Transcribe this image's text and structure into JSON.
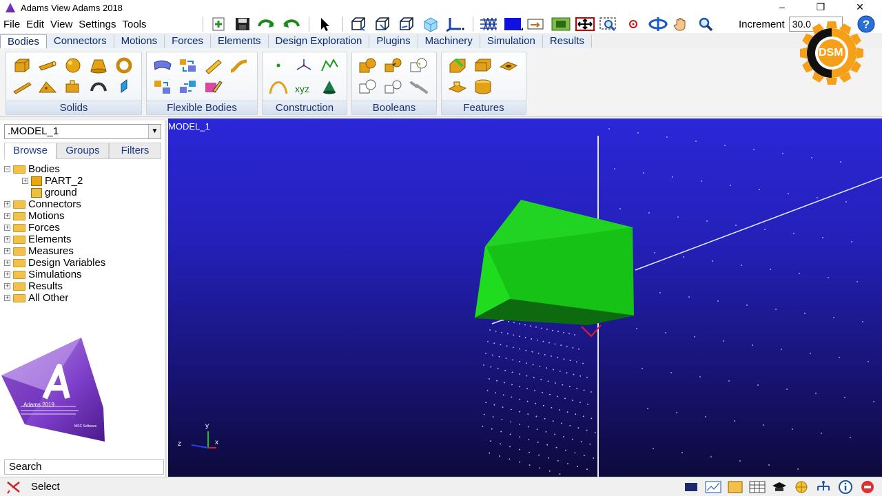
{
  "window": {
    "title": "Adams View Adams 2018",
    "min_glyph": "–",
    "max_glyph": "❐",
    "close_glyph": "✕"
  },
  "menu": {
    "items": [
      "File",
      "Edit",
      "View",
      "Settings",
      "Tools"
    ]
  },
  "toolbar": {
    "increment_label": "Increment",
    "increment_value": "30.0"
  },
  "ribbon": {
    "tabs": [
      "Bodies",
      "Connectors",
      "Motions",
      "Forces",
      "Elements",
      "Design Exploration",
      "Plugins",
      "Machinery",
      "Simulation",
      "Results"
    ],
    "groups": {
      "solids": "Solids",
      "flexible": "Flexible Bodies",
      "construction": "Construction",
      "booleans": "Booleans",
      "features": "Features"
    }
  },
  "browser": {
    "model": ".MODEL_1",
    "tabs": [
      "Browse",
      "Groups",
      "Filters"
    ],
    "tree": {
      "bodies": "Bodies",
      "part2": "PART_2",
      "ground": "ground",
      "connectors": "Connectors",
      "motions": "Motions",
      "forces": "Forces",
      "elements": "Elements",
      "measures": "Measures",
      "design_variables": "Design Variables",
      "simulations": "Simulations",
      "results": "Results",
      "all_other": "All Other"
    },
    "search_placeholder": "Search"
  },
  "splash": {
    "product": "Adams 2019",
    "vendor": "MSC Software",
    "letter": "A"
  },
  "viewport": {
    "label": "MODEL_1",
    "axis_x": "x",
    "axis_y": "y",
    "axis_z": "z",
    "body_color": "#1bd11b",
    "bg_color": "#2420b8"
  },
  "watermark": {
    "text": "DSM"
  },
  "status": {
    "mode": "Select"
  }
}
